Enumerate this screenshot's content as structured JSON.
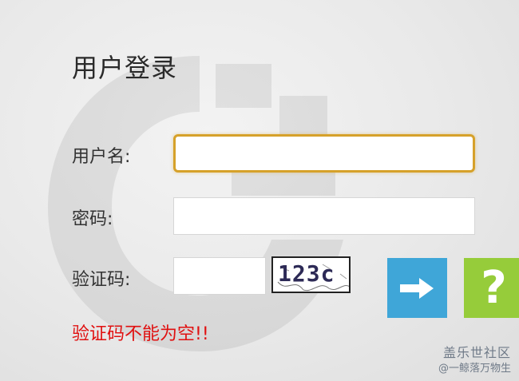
{
  "page": {
    "title": "用户登录"
  },
  "form": {
    "username_label": "用户名:",
    "username_value": "",
    "password_label": "密码:",
    "password_value": "",
    "captcha_label": "验证码:",
    "captcha_value": "",
    "captcha_image_text": "123c",
    "error_message": "验证码不能为空!!"
  },
  "buttons": {
    "submit_icon": "arrow-right-icon",
    "help_icon": "question-icon",
    "help_glyph": "?"
  },
  "colors": {
    "focus_border": "#d6a12a",
    "submit_bg": "#3fa6d8",
    "help_bg": "#96cc3a",
    "error": "#e01010"
  },
  "watermark": {
    "line1": "盖乐世社区",
    "line2": "@一鲸落万物生"
  }
}
